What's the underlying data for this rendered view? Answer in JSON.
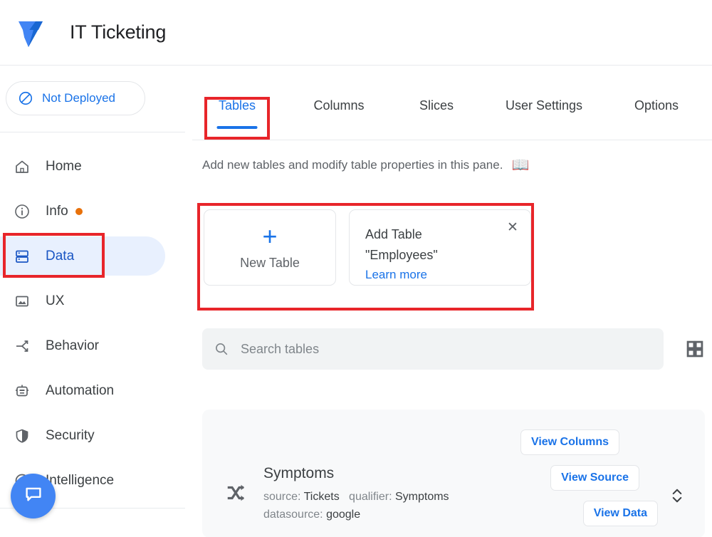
{
  "header": {
    "app_title": "IT Ticketing",
    "logo_icon": "appsheet-logo-icon"
  },
  "sidebar": {
    "deploy_status": {
      "label": "Not Deployed",
      "icon": "not-deployed-slash-circle-icon",
      "color": "#1a73e8"
    },
    "items": [
      {
        "label": "Home",
        "icon": "home-icon",
        "active": false,
        "badge": false
      },
      {
        "label": "Info",
        "icon": "info-circle-icon",
        "active": false,
        "badge": true
      },
      {
        "label": "Data",
        "icon": "data-server-icon",
        "active": true,
        "badge": false
      },
      {
        "label": "UX",
        "icon": "image-picture-icon",
        "active": false,
        "badge": false
      },
      {
        "label": "Behavior",
        "icon": "behavior-branch-icon",
        "active": false,
        "badge": false
      },
      {
        "label": "Automation",
        "icon": "robot-icon",
        "active": false,
        "badge": false
      },
      {
        "label": "Security",
        "icon": "shield-icon",
        "active": false,
        "badge": false
      },
      {
        "label": "Intelligence",
        "icon": "intelligence-icon",
        "active": false,
        "badge": false
      }
    ],
    "chat_fab": {
      "icon": "chat-bubble-icon",
      "color": "#4285f4"
    }
  },
  "main": {
    "tabs": [
      {
        "label": "Tables",
        "active": true
      },
      {
        "label": "Columns",
        "active": false
      },
      {
        "label": "Slices",
        "active": false
      },
      {
        "label": "User Settings",
        "active": false
      },
      {
        "label": "Options",
        "active": false
      }
    ],
    "pane_description": "Add new tables and modify table properties in this pane.",
    "pane_description_icon": "📖",
    "new_table_card": {
      "plus_icon": "+",
      "label": "New Table"
    },
    "add_table_suggestion": {
      "title": "Add Table \"Employees\"",
      "learn_more": "Learn more",
      "close_icon": "✕"
    },
    "search": {
      "placeholder": "Search tables",
      "value": "",
      "icon": "search-icon"
    },
    "view_toggle_icon": "grid-view-icon",
    "tables": [
      {
        "name": "Symptoms",
        "icon": "shuffle-slice-icon",
        "meta": {
          "source_label": "source:",
          "source_value": "Tickets",
          "qualifier_label": "qualifier:",
          "qualifier_value": "Symptoms",
          "datasource_label": "datasource:",
          "datasource_value": "google"
        },
        "buttons": [
          "View Columns",
          "View Source",
          "View Data"
        ],
        "expander_icon": "expand-collapse-chevrons-icon"
      }
    ]
  },
  "annotations": {
    "color": "#e8252a",
    "boxes": [
      {
        "target": "tables-tab"
      },
      {
        "target": "data-nav-item"
      },
      {
        "target": "add-table-row"
      }
    ]
  }
}
